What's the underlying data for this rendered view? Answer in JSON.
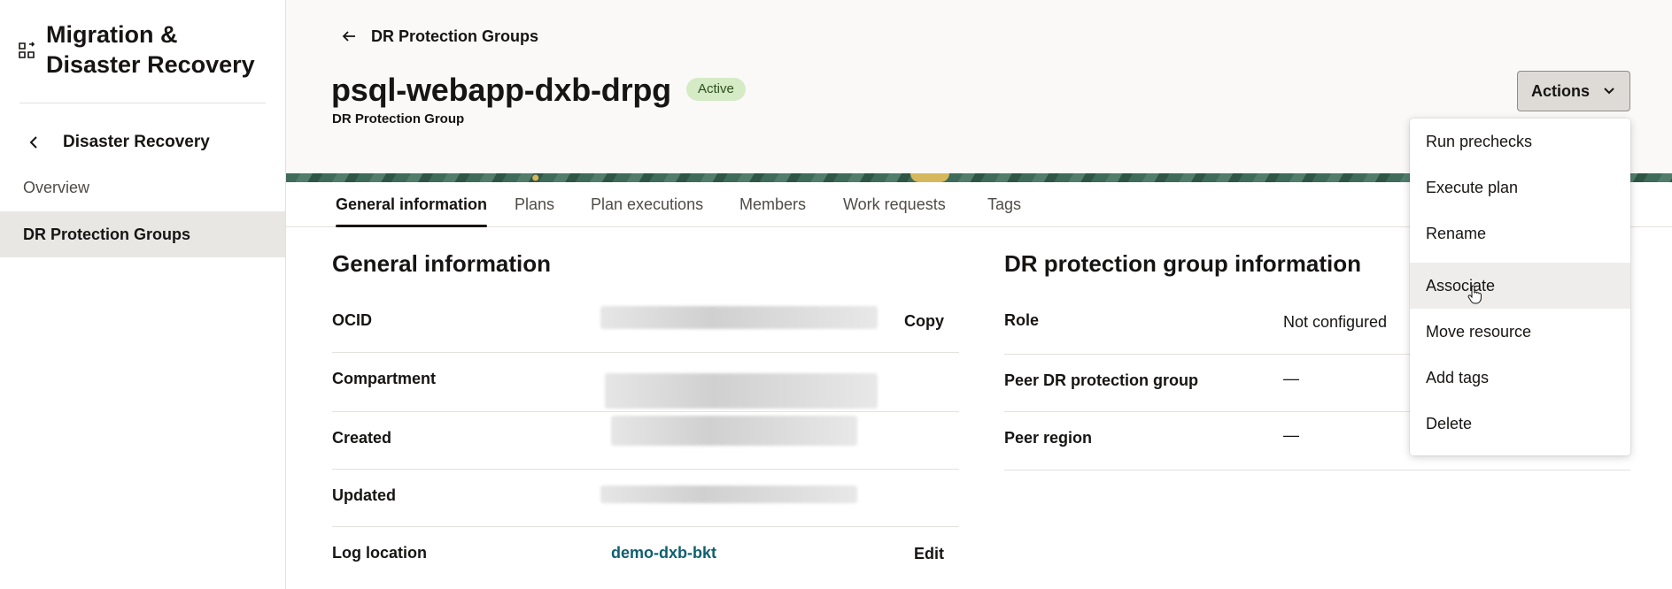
{
  "sidebar": {
    "app_title": "Migration & Disaster Recovery",
    "app_icon": "migration-icon",
    "back_label": "Disaster Recovery",
    "items": [
      {
        "label": "Overview",
        "active": false
      },
      {
        "label": "DR Protection Groups",
        "active": true
      }
    ]
  },
  "header": {
    "breadcrumb": "DR Protection Groups",
    "title": "psql-webapp-dxb-drpg",
    "status": "Active",
    "status_color": "#d4ebc6",
    "subtitle": "DR Protection Group",
    "actions_label": "Actions"
  },
  "tabs": [
    {
      "label": "General information",
      "active": true
    },
    {
      "label": "Plans",
      "active": false
    },
    {
      "label": "Plan executions",
      "active": false
    },
    {
      "label": "Members",
      "active": false
    },
    {
      "label": "Work requests",
      "active": false
    },
    {
      "label": "Tags",
      "active": false
    }
  ],
  "general": {
    "title": "General information",
    "rows": [
      {
        "label": "OCID",
        "action": "Copy"
      },
      {
        "label": "Compartment"
      },
      {
        "label": "Created"
      },
      {
        "label": "Updated"
      },
      {
        "label": "Log location",
        "value": "demo-dxb-bkt",
        "action": "Edit"
      }
    ]
  },
  "dr_info": {
    "title": "DR protection group information",
    "rows": [
      {
        "label": "Role",
        "value": "Not configured"
      },
      {
        "label": "Peer DR protection group",
        "value": "—"
      },
      {
        "label": "Peer region",
        "value": "—"
      }
    ]
  },
  "actions_menu": {
    "items": [
      "Run prechecks",
      "Execute plan",
      "Rename",
      "Associate",
      "Move resource",
      "Add tags",
      "Delete"
    ],
    "hovered": "Associate"
  },
  "colors": {
    "link": "#0f5f70",
    "active_nav_bg": "#e9e7e4",
    "header_bg": "#fbf9f8"
  }
}
